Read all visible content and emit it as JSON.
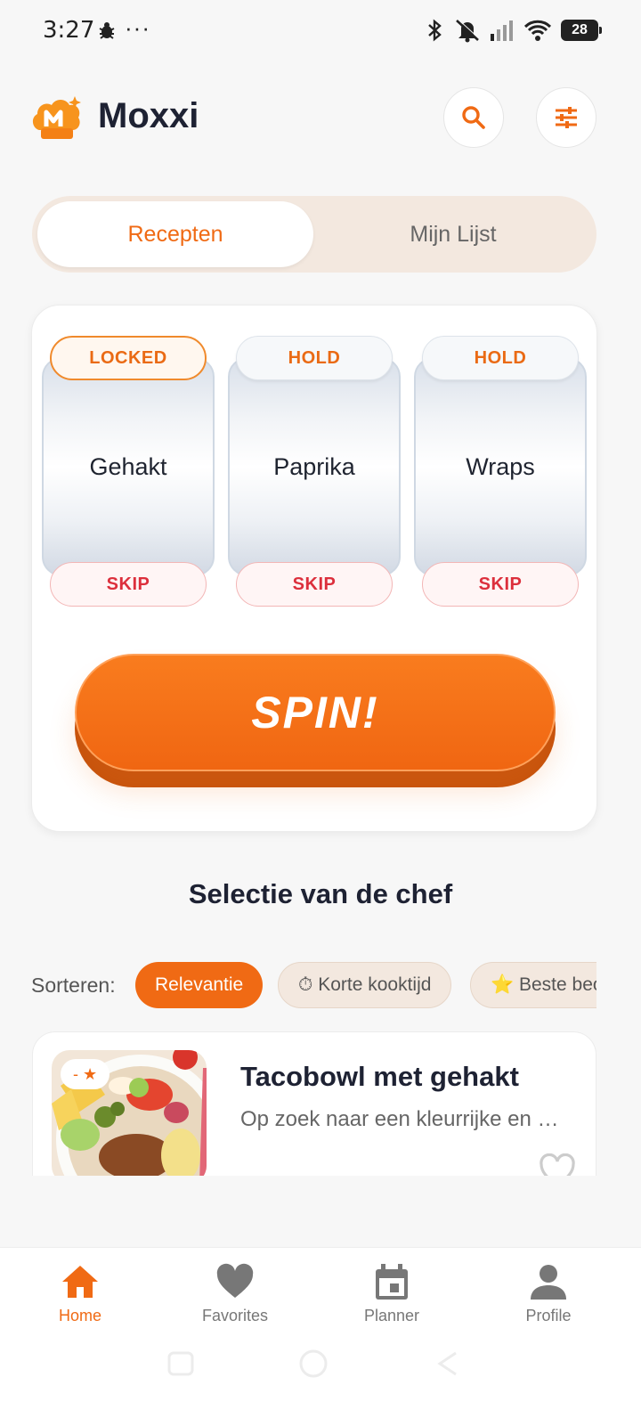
{
  "status_bar": {
    "time": "3:27",
    "dots": "···",
    "battery": "28"
  },
  "header": {
    "title": "Moxxi"
  },
  "tabs": [
    {
      "label": "Recepten",
      "active": true
    },
    {
      "label": "Mijn Lijst",
      "active": false
    }
  ],
  "slots": [
    {
      "ingredient": "Gehakt",
      "top_label": "LOCKED",
      "bottom_label": "SKIP"
    },
    {
      "ingredient": "Paprika",
      "top_label": "HOLD",
      "bottom_label": "SKIP"
    },
    {
      "ingredient": "Wraps",
      "top_label": "HOLD",
      "bottom_label": "SKIP"
    }
  ],
  "spin_label": "SPIN!",
  "section": {
    "title": "Selectie van de chef"
  },
  "sort": {
    "label": "Sorteren:",
    "chips": [
      {
        "label": "Relevantie",
        "active": true
      },
      {
        "label": "⏱ Korte kooktijd",
        "active": false
      },
      {
        "label": "⭐ Beste beoordeeld",
        "active": false
      }
    ]
  },
  "recipe": {
    "rating": "- ★",
    "title": "Tacobowl met gehakt",
    "description": "Op zoek naar een kleurrijke en …"
  },
  "nav": [
    {
      "label": "Home",
      "icon": "home-icon",
      "active": true
    },
    {
      "label": "Favorites",
      "icon": "heart-icon",
      "active": false
    },
    {
      "label": "Planner",
      "icon": "calendar-icon",
      "active": false
    },
    {
      "label": "Profile",
      "icon": "person-icon",
      "active": false
    }
  ],
  "colors": {
    "accent": "#f06a14",
    "skip": "#dc2f3c",
    "text": "#1e2233"
  }
}
